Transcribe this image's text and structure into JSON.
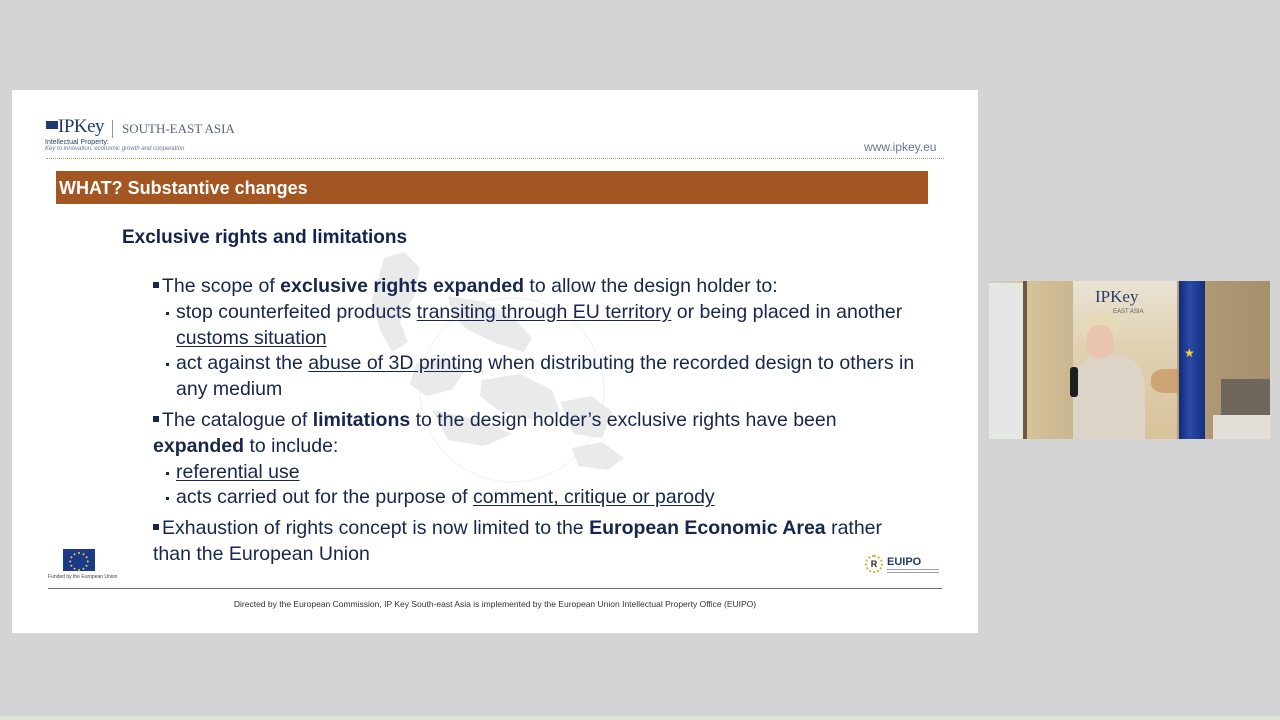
{
  "slide": {
    "logo": {
      "name": "IPKey",
      "region": "SOUTH-EAST ASIA",
      "subtitle": "Intellectual Property:",
      "tagline": "Key to innovation, economic growth and cooperation"
    },
    "website": "www.ipkey.eu",
    "title": "WHAT? Substantive changes",
    "subtitle": "Exclusive rights and limitations",
    "bullet1": {
      "pre": "The scope of ",
      "bold": "exclusive rights expanded",
      "post": " to allow the design holder to:",
      "sub1": {
        "pre": "stop counterfeited products ",
        "u1": "transiting through EU territory",
        "mid": " or being placed in another ",
        "u2": "customs situation"
      },
      "sub2": {
        "pre": "act against the ",
        "u1": "abuse of 3D printing",
        "post": " when distributing the recorded design to others in any medium"
      }
    },
    "bullet2": {
      "pre": "The catalogue of ",
      "bold1": "limitations",
      "mid": " to the design holder’s exclusive rights have been ",
      "bold2": "expanded",
      "post": " to include:",
      "sub1": "referential use",
      "sub2": {
        "pre": "acts carried out for the purpose of ",
        "u1": "comment, critique or parody"
      }
    },
    "bullet3": {
      "pre": "Exhaustion of rights concept is now limited to the ",
      "bold": "European Economic Area",
      "post": " rather than the European Union"
    },
    "eu_caption": "Funded by the European Union",
    "euipo_label": "EUIPO",
    "footer": "Directed by the European Commission, IP Key South-east Asia is implemented by the European Union Intellectual Property Office (EUIPO)"
  },
  "video": {
    "banner_logo": "IPKey",
    "banner_region": "EAST ASIA"
  },
  "colors": {
    "title_bar": "#a35522",
    "text": "#17264d",
    "background": "#d4d4d4"
  }
}
